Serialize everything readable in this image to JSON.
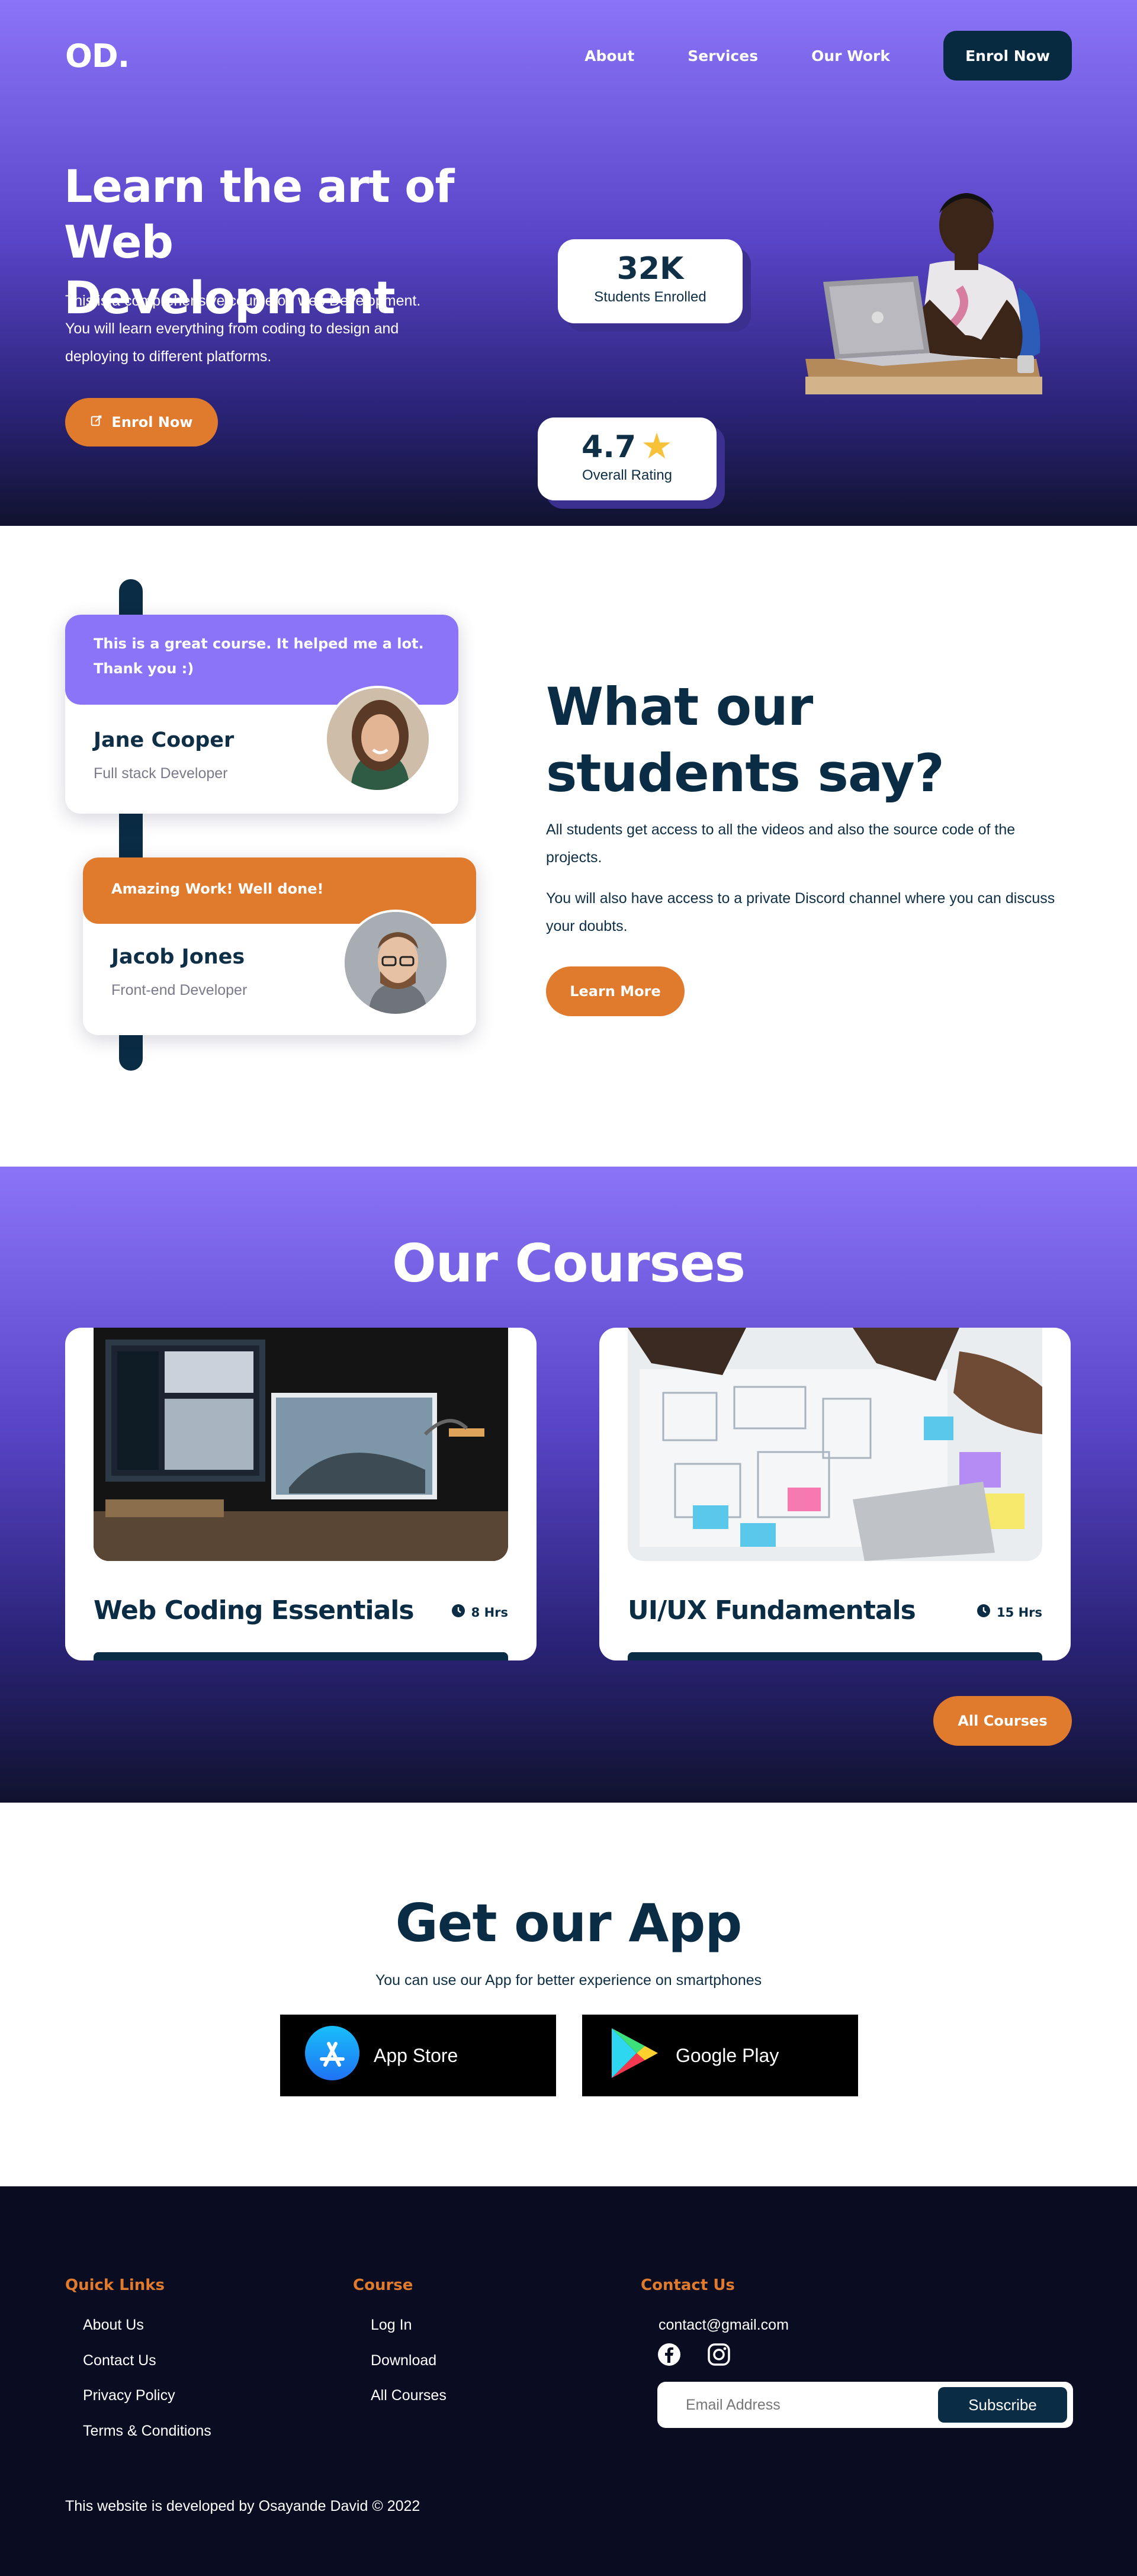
{
  "nav": {
    "logo": "OD.",
    "links": [
      "About",
      "Services",
      "Our Work"
    ],
    "enrol": "Enrol Now"
  },
  "hero": {
    "title_line1": "Learn the art of",
    "title_line2": "Web Development",
    "text_line1": "This is a comprehensive course on web Development.",
    "text_line2": "You will learn everything from coding to design and",
    "text_line3": "deploying to different platforms.",
    "button": "Enrol Now",
    "stat1_value": "32K",
    "stat1_label": "Students Enrolled",
    "stat2_value": "4.7",
    "stat2_label": "Overall Rating"
  },
  "testimonials": {
    "cards": [
      {
        "quote": "This is a great course. It helped me a lot. Thank you :)",
        "name": "Jane Cooper",
        "role": "Full stack Developer"
      },
      {
        "quote": "Amazing Work! Well done!",
        "name": "Jacob Jones",
        "role": "Front-end Developer"
      }
    ],
    "heading": "What our students say?",
    "para1": "All students get access to all the videos and also the source code of the projects.",
    "para2": "You will also have access to a private Discord channel where you can discuss your doubts.",
    "button": "Learn More"
  },
  "courses": {
    "heading": "Our Courses",
    "items": [
      {
        "name": "Web Coding Essentials",
        "hours": "8 Hrs"
      },
      {
        "name": "UI/UX Fundamentals",
        "hours": "15 Hrs"
      }
    ],
    "button": "All Courses"
  },
  "app": {
    "heading": "Get our App",
    "subtitle": "You can use our App for better experience on smartphones",
    "stores": [
      "App Store",
      "Google Play"
    ]
  },
  "footer": {
    "quick_links_title": "Quick Links",
    "quick_links": [
      "About Us",
      "Contact Us",
      "Privacy Policy",
      "Terms & Conditions"
    ],
    "course_title": "Course",
    "course_links": [
      "Log In",
      "Download",
      "All Courses"
    ],
    "contact_title": "Contact Us",
    "email": "contact@gmail.com",
    "subscribe_placeholder": "Email Address",
    "subscribe_button": "Subscribe",
    "copyright": "This website is developed by Osayande David © 2022"
  },
  "colors": {
    "primary_purple": "#8b74f7",
    "accent_orange": "#e07b2e",
    "navy": "#0a2c44",
    "footer_bg": "#0a0d22",
    "star": "#f7c23a"
  },
  "icons": [
    "edit-icon",
    "star-icon",
    "clock-icon",
    "app-store-icon",
    "google-play-icon",
    "facebook-icon",
    "instagram-icon"
  ]
}
